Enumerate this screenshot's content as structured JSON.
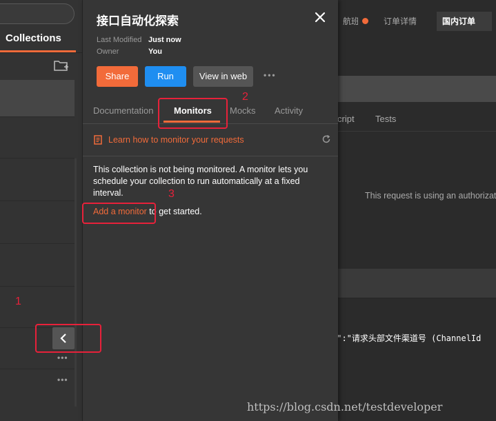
{
  "sidebar": {
    "collections_tab": "Collections"
  },
  "panel": {
    "title": "接口自动化探索",
    "last_modified_label": "Last Modified",
    "last_modified_value": "Just now",
    "owner_label": "Owner",
    "owner_value": "You",
    "buttons": {
      "share": "Share",
      "run": "Run",
      "view_in_web": "View in web"
    },
    "tabs": [
      "Documentation",
      "Monitors",
      "Mocks",
      "Activity"
    ],
    "learn_link": "Learn how to monitor your requests",
    "description": "This collection is not being monitored. A monitor lets you schedule your collection to run automatically at a fixed interval.",
    "add_monitor_link": "Add a monitor",
    "add_monitor_suffix": " to get started."
  },
  "main": {
    "tabs": [
      "航班",
      "订单详情",
      "国内订单"
    ],
    "request_tabs": [
      "cript",
      "Tests"
    ],
    "auth_message": "This request is using an authorizat",
    "code_line": "e\":\"请求头部文件渠道号 (ChannelId"
  },
  "annotations": [
    "1",
    "2",
    "3"
  ],
  "watermark": "https://blog.csdn.net/testdeveloper",
  "colors": {
    "accent": "#f26b3a",
    "run_blue": "#1f8ef1",
    "annotation_red": "#e8213a"
  }
}
